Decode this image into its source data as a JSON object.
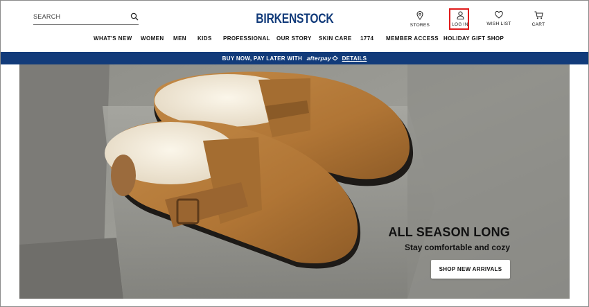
{
  "header": {
    "search_placeholder": "SEARCH",
    "logo_text": "BIRKENSTOCK",
    "utility": [
      {
        "label": "STORES",
        "icon": "location-pin-icon"
      },
      {
        "label": "LOG IN",
        "icon": "user-icon"
      },
      {
        "label": "WISH LIST",
        "icon": "heart-icon"
      },
      {
        "label": "CART",
        "icon": "cart-icon"
      }
    ]
  },
  "nav": {
    "items": [
      "WHAT'S NEW",
      "WOMEN",
      "MEN",
      "KIDS",
      "PROFESSIONAL",
      "OUR STORY",
      "SKIN CARE",
      "1774",
      "MEMBER ACCESS",
      "HOLIDAY GIFT SHOP"
    ]
  },
  "promo": {
    "text": "BUY NOW, PAY LATER WITH",
    "brand": "afterpay",
    "link": "DETAILS"
  },
  "hero": {
    "title": "ALL SEASON LONG",
    "subtitle": "Stay comfortable and cozy",
    "cta": "SHOP NEW ARRIVALS"
  },
  "colors": {
    "brand_blue": "#123b7a",
    "highlight_red": "#e01b1b",
    "suede": "#b47a3a"
  }
}
